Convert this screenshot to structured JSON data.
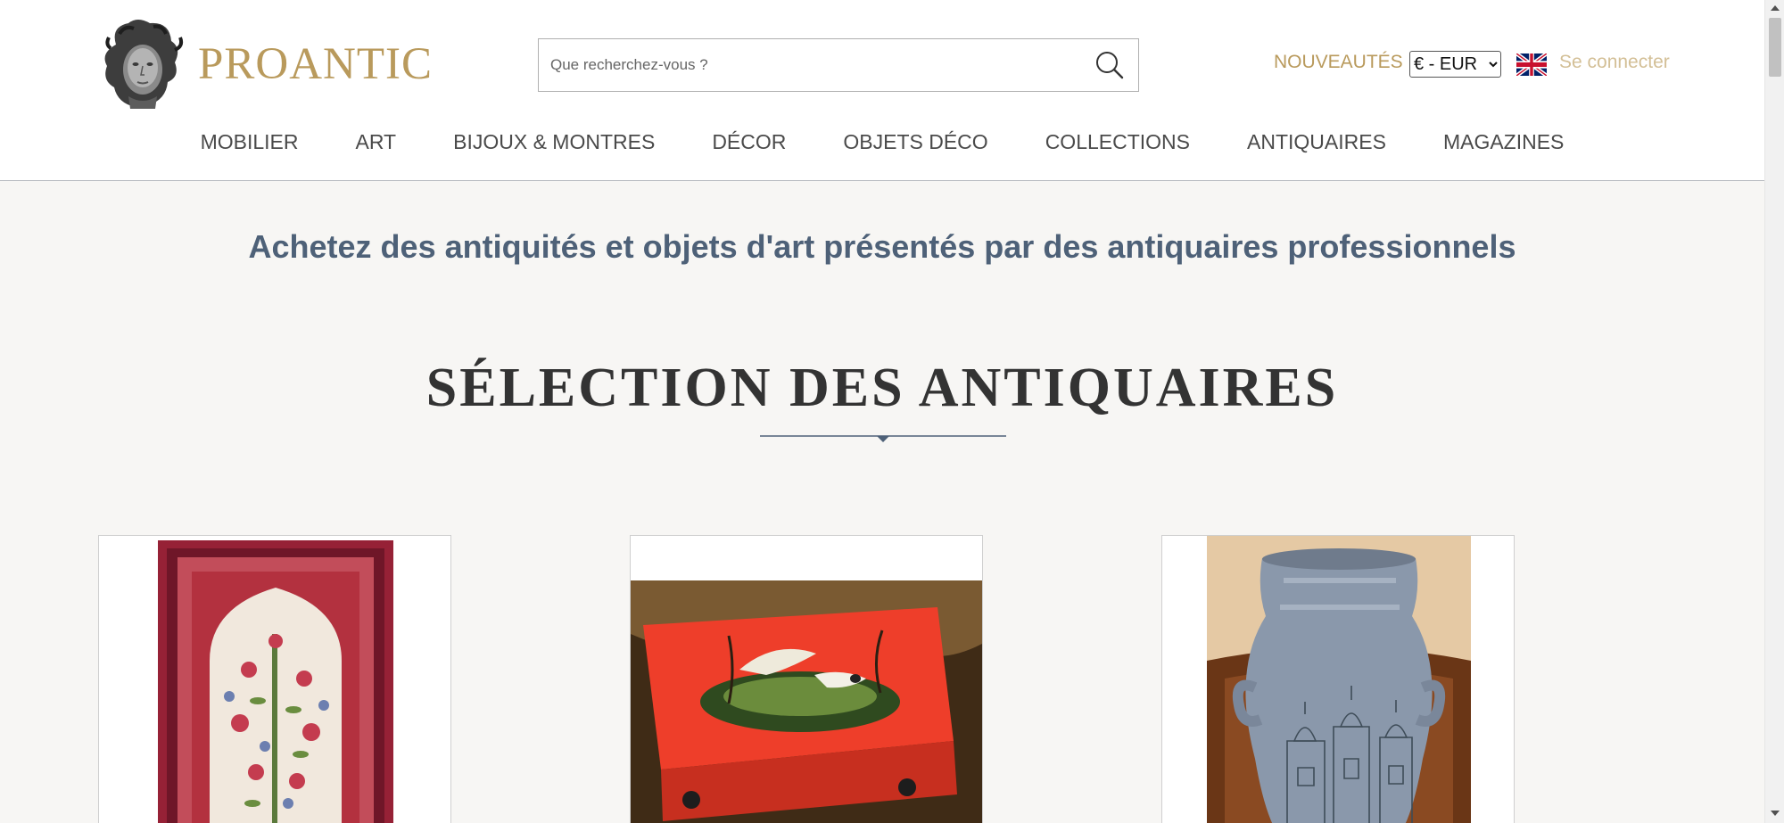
{
  "header": {
    "logo_text": "PROANTIC",
    "search": {
      "placeholder": "Que recherchez-vous ?"
    },
    "nouveautes_label": "NOUVEAUTÉS",
    "currency": {
      "selected": "€ - EUR"
    },
    "language_icon": "uk-flag-icon",
    "login_label": "Se connecter",
    "colors": {
      "gold": "#b99a5c",
      "gold_light": "#d3bf96"
    }
  },
  "nav": {
    "items": [
      {
        "label": "MOBILIER"
      },
      {
        "label": "ART"
      },
      {
        "label": "BIJOUX & MONTRES"
      },
      {
        "label": "DÉCOR"
      },
      {
        "label": "OBJETS DÉCO"
      },
      {
        "label": "COLLECTIONS"
      },
      {
        "label": "ANTIQUAIRES"
      },
      {
        "label": "MAGAZINES"
      }
    ]
  },
  "main": {
    "tagline": "Achetez des antiquités et objets d'art présentés par des antiquaires professionnels",
    "section_title": "SÉLECTION DES ANTIQUAIRES",
    "products": [
      {
        "image": "persian-rug-image"
      },
      {
        "image": "red-lacquered-box-image"
      },
      {
        "image": "blue-ceramic-vase-image"
      }
    ]
  }
}
